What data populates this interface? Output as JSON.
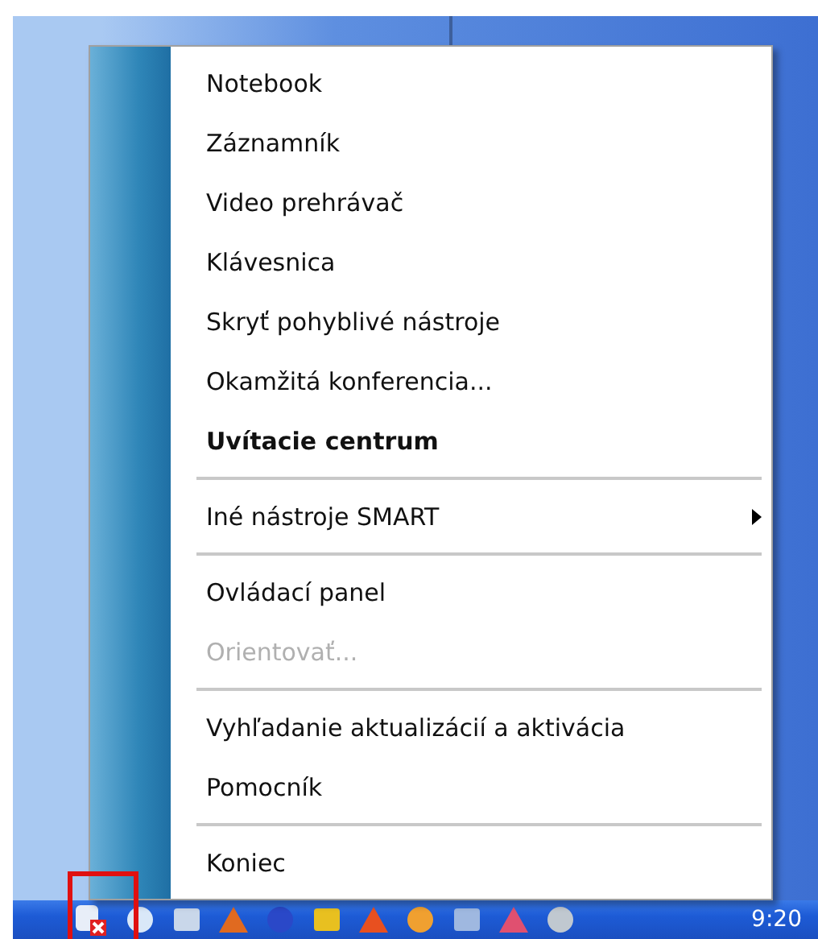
{
  "menu": {
    "items": [
      {
        "kind": "item",
        "label": "Notebook",
        "default": false,
        "disabled": false,
        "submenu": false
      },
      {
        "kind": "item",
        "label": "Záznamník",
        "default": false,
        "disabled": false,
        "submenu": false
      },
      {
        "kind": "item",
        "label": "Video prehrávač",
        "default": false,
        "disabled": false,
        "submenu": false
      },
      {
        "kind": "item",
        "label": "Klávesnica",
        "default": false,
        "disabled": false,
        "submenu": false
      },
      {
        "kind": "item",
        "label": "Skryť pohyblivé nástroje",
        "default": false,
        "disabled": false,
        "submenu": false
      },
      {
        "kind": "item",
        "label": "Okamžitá konferencia...",
        "default": false,
        "disabled": false,
        "submenu": false
      },
      {
        "kind": "item",
        "label": "Uvítacie centrum",
        "default": true,
        "disabled": false,
        "submenu": false
      },
      {
        "kind": "separator"
      },
      {
        "kind": "item",
        "label": "Iné nástroje SMART",
        "default": false,
        "disabled": false,
        "submenu": true
      },
      {
        "kind": "separator"
      },
      {
        "kind": "item",
        "label": "Ovládací panel",
        "default": false,
        "disabled": false,
        "submenu": false
      },
      {
        "kind": "item",
        "label": "Orientovať...",
        "default": false,
        "disabled": true,
        "submenu": false
      },
      {
        "kind": "separator"
      },
      {
        "kind": "item",
        "label": "Vyhľadanie aktualizácií a aktivácia",
        "default": false,
        "disabled": false,
        "submenu": false
      },
      {
        "kind": "item",
        "label": "Pomocník",
        "default": false,
        "disabled": false,
        "submenu": false
      },
      {
        "kind": "separator"
      },
      {
        "kind": "item",
        "label": "Koniec",
        "default": false,
        "disabled": false,
        "submenu": false
      }
    ]
  },
  "taskbar": {
    "clock": "9:20"
  }
}
